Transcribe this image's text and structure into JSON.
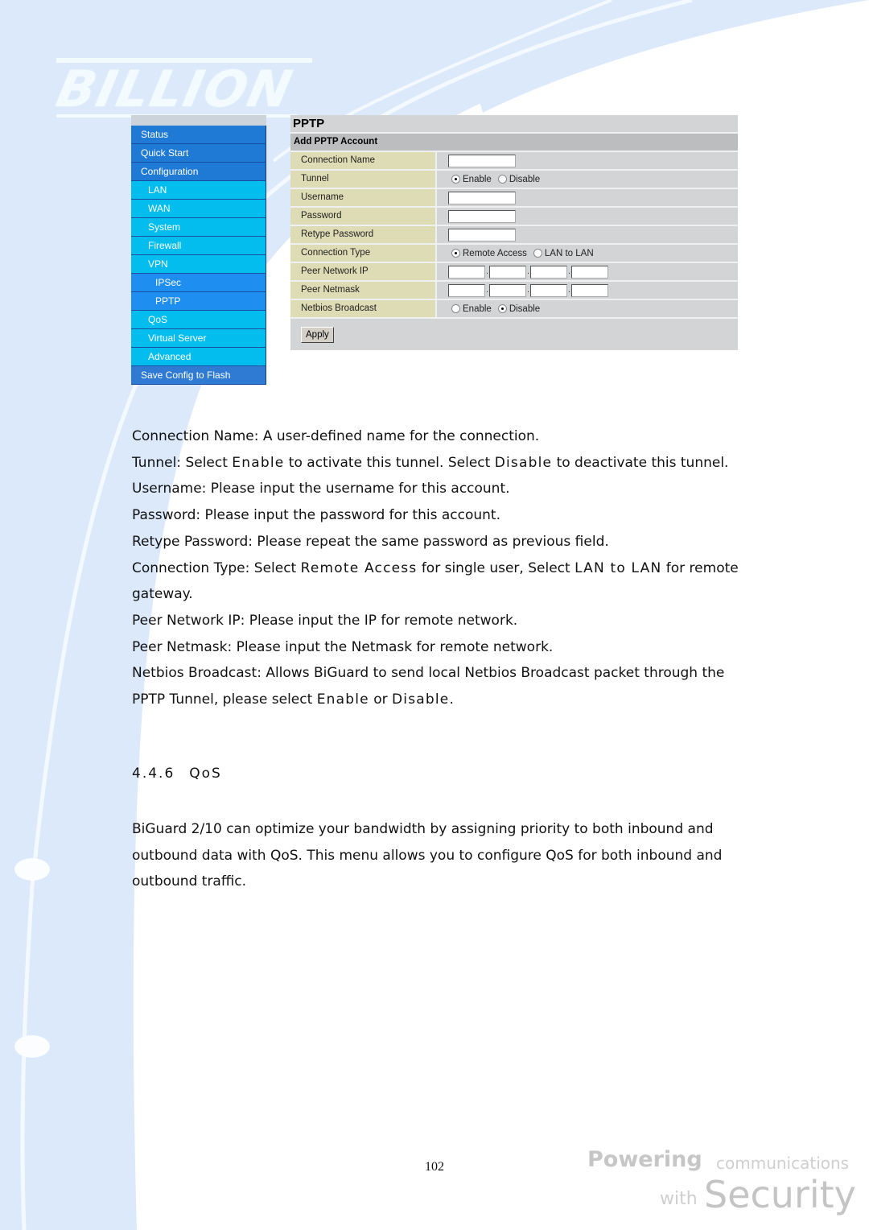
{
  "brand": {
    "logo_text": "BILLION",
    "tagline_line1_bold": "Powering",
    "tagline_line1_rest": "communications",
    "tagline_line2_small": "with",
    "tagline_line2_large": "Security"
  },
  "sidebar": {
    "items": [
      {
        "label": "Status",
        "level": 0
      },
      {
        "label": "Quick Start",
        "level": 0
      },
      {
        "label": "Configuration",
        "level": 0
      },
      {
        "label": "LAN",
        "level": 1
      },
      {
        "label": "WAN",
        "level": 1
      },
      {
        "label": "System",
        "level": 1
      },
      {
        "label": "Firewall",
        "level": 1
      },
      {
        "label": "VPN",
        "level": 1
      },
      {
        "label": "IPSec",
        "level": 2
      },
      {
        "label": "PPTP",
        "level": 2
      },
      {
        "label": "QoS",
        "level": 1
      },
      {
        "label": "Virtual Server",
        "level": 1
      },
      {
        "label": "Advanced",
        "level": 1
      },
      {
        "label": "Save Config to Flash",
        "level": 0
      }
    ]
  },
  "panel": {
    "title": "PPTP",
    "subtitle": "Add PPTP Account",
    "fields": {
      "connection_name": {
        "label": "Connection Name",
        "value": ""
      },
      "tunnel": {
        "label": "Tunnel",
        "options": [
          "Enable",
          "Disable"
        ],
        "selected": "Enable"
      },
      "username": {
        "label": "Username",
        "value": ""
      },
      "password": {
        "label": "Password",
        "value": ""
      },
      "retype_password": {
        "label": "Retype Password",
        "value": ""
      },
      "connection_type": {
        "label": "Connection Type",
        "options": [
          "Remote Access",
          "LAN to LAN"
        ],
        "selected": "Remote Access"
      },
      "peer_network_ip": {
        "label": "Peer Network IP",
        "octets": [
          "",
          "",
          "",
          ""
        ],
        "separator": "."
      },
      "peer_netmask": {
        "label": "Peer Netmask",
        "octets": [
          "",
          "",
          "",
          ""
        ],
        "separator": "."
      },
      "netbios_broadcast": {
        "label": "Netbios Broadcast",
        "options": [
          "Enable",
          "Disable"
        ],
        "selected": "Disable"
      }
    },
    "apply_label": "Apply"
  },
  "doc": {
    "lines": {
      "conn_name": "Connection Name: A user-defined name for the connection.",
      "tunnel_a": "Tunnel: Select ",
      "tunnel_enable": "Enable",
      "tunnel_b": " to activate this tunnel. Select ",
      "tunnel_disable": "Disable",
      "tunnel_c": " to deactivate this tunnel.",
      "username": "Username: Please input the username for this account.",
      "password": "Password: Please input the password for this account.",
      "retype": "Retype Password: Please repeat the same password as previous field.",
      "conntype_a": "Connection Type: Select ",
      "conntype_remote": "Remote Access",
      "conntype_b": " for single user, Select ",
      "conntype_lan": "LAN to LAN",
      "conntype_c": " for remote gateway.",
      "peer_ip": "Peer Network IP: Please input the IP for remote network.",
      "peer_mask": "Peer Netmask: Please input the Netmask for remote network.",
      "netbios_a": "Netbios Broadcast: Allows BiGuard to send local Netbios Broadcast packet through the PPTP Tunnel, please select ",
      "netbios_enable": "Enable",
      "netbios_or": " or ",
      "netbios_disable": "Disable",
      "netbios_end": "."
    },
    "section_number": "4.4.6",
    "section_title": "QoS",
    "intro": "BiGuard 2/10 can optimize your bandwidth by assigning priority to both inbound and outbound data with QoS. This menu allows you to configure QoS for both inbound and outbound traffic."
  },
  "page_number": "102"
}
